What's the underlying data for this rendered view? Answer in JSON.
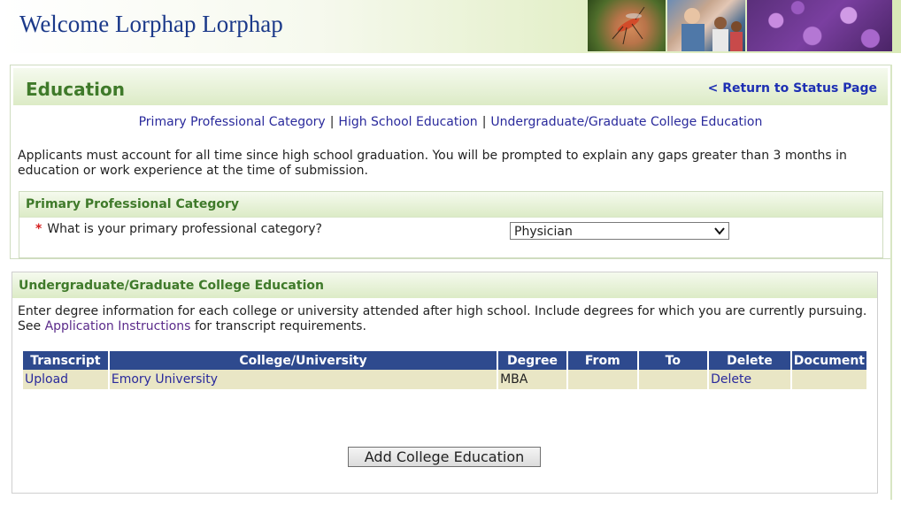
{
  "header": {
    "welcome": "Welcome Lorphap Lorphap"
  },
  "education": {
    "title": "Education",
    "return_link": "< Return to Status Page",
    "subnav": [
      "Primary Professional Category",
      "High School Education",
      "Undergraduate/Graduate College Education"
    ],
    "subnav_sep": "|",
    "intro": "Applicants must account for all time since high school graduation. You will be prompted to explain any gaps greater than 3 months in education or work experience at the time of submission."
  },
  "primary_category": {
    "title": "Primary Professional Category",
    "required_mark": "*",
    "question": "What is your primary professional category?",
    "selected": "Physician"
  },
  "college": {
    "title": "Undergraduate/Graduate College Education",
    "intro_line1": "Enter degree information for each college or university attended after high school. Include degrees for which you are currently pursuing.",
    "intro_see": "See",
    "intro_link": "Application Instructions",
    "intro_rest": "for transcript requirements.",
    "columns": [
      "Transcript",
      "College/University",
      "Degree",
      "From",
      "To",
      "Delete",
      "Document"
    ],
    "rows": [
      {
        "transcript": "Upload",
        "college": "Emory University",
        "degree": "MBA",
        "from": "",
        "to": "",
        "delete": "Delete",
        "document": ""
      }
    ],
    "add_button": "Add College Education"
  }
}
